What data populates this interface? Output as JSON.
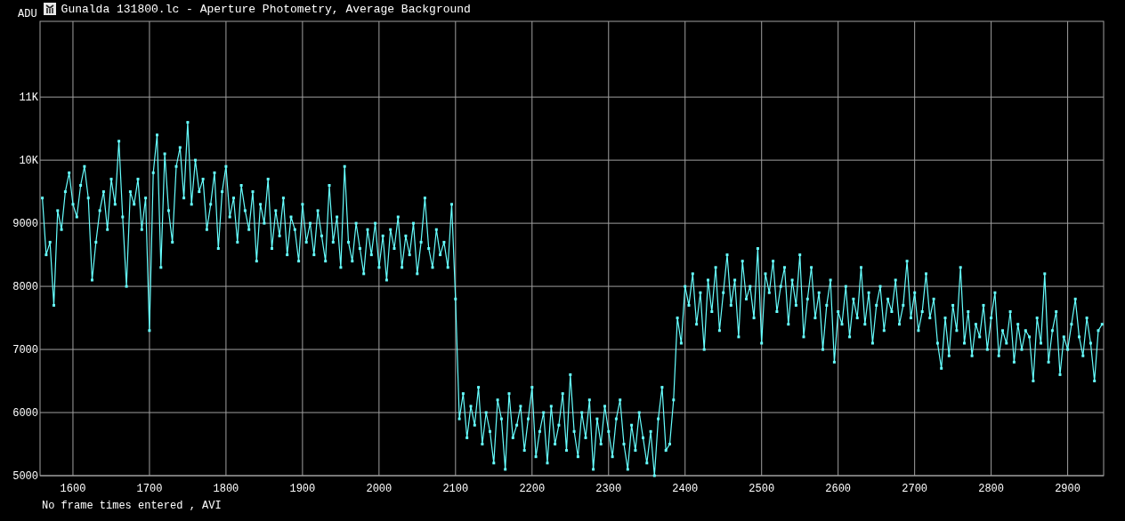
{
  "window": {
    "title": "Gunalda 131800.lc - Aperture Photometry, Average Background"
  },
  "chart_data": {
    "type": "line",
    "grid": true,
    "ylabel": "ADU",
    "xlim": [
      1557,
      2947
    ],
    "ylim": [
      5000,
      12200
    ],
    "xticks": [
      1600,
      1700,
      1800,
      1900,
      2000,
      2100,
      2200,
      2300,
      2400,
      2500,
      2600,
      2700,
      2800,
      2900
    ],
    "yticks": [
      5000,
      6000,
      7000,
      8000,
      9000,
      {
        "value": 10000,
        "label": "10K"
      },
      {
        "value": 11000,
        "label": "11K"
      }
    ],
    "x": [
      1560,
      1565,
      1570,
      1575,
      1580,
      1585,
      1590,
      1595,
      1600,
      1605,
      1610,
      1615,
      1620,
      1625,
      1630,
      1635,
      1640,
      1645,
      1650,
      1655,
      1660,
      1665,
      1670,
      1675,
      1680,
      1685,
      1690,
      1695,
      1700,
      1705,
      1710,
      1715,
      1720,
      1725,
      1730,
      1735,
      1740,
      1745,
      1750,
      1755,
      1760,
      1765,
      1770,
      1775,
      1780,
      1785,
      1790,
      1795,
      1800,
      1805,
      1810,
      1815,
      1820,
      1825,
      1830,
      1835,
      1840,
      1845,
      1850,
      1855,
      1860,
      1865,
      1870,
      1875,
      1880,
      1885,
      1890,
      1895,
      1900,
      1905,
      1910,
      1915,
      1920,
      1925,
      1930,
      1935,
      1940,
      1945,
      1950,
      1955,
      1960,
      1965,
      1970,
      1975,
      1980,
      1985,
      1990,
      1995,
      2000,
      2005,
      2010,
      2015,
      2020,
      2025,
      2030,
      2035,
      2040,
      2045,
      2050,
      2055,
      2060,
      2065,
      2070,
      2075,
      2080,
      2085,
      2090,
      2095,
      2100,
      2105,
      2110,
      2115,
      2120,
      2125,
      2130,
      2135,
      2140,
      2145,
      2150,
      2155,
      2160,
      2165,
      2170,
      2175,
      2180,
      2185,
      2190,
      2195,
      2200,
      2205,
      2210,
      2215,
      2220,
      2225,
      2230,
      2235,
      2240,
      2245,
      2250,
      2255,
      2260,
      2265,
      2270,
      2275,
      2280,
      2285,
      2290,
      2295,
      2300,
      2305,
      2310,
      2315,
      2320,
      2325,
      2330,
      2335,
      2340,
      2345,
      2350,
      2355,
      2360,
      2365,
      2370,
      2375,
      2380,
      2385,
      2390,
      2395,
      2400,
      2405,
      2410,
      2415,
      2420,
      2425,
      2430,
      2435,
      2440,
      2445,
      2450,
      2455,
      2460,
      2465,
      2470,
      2475,
      2480,
      2485,
      2490,
      2495,
      2500,
      2505,
      2510,
      2515,
      2520,
      2525,
      2530,
      2535,
      2540,
      2545,
      2550,
      2555,
      2560,
      2565,
      2570,
      2575,
      2580,
      2585,
      2590,
      2595,
      2600,
      2605,
      2610,
      2615,
      2620,
      2625,
      2630,
      2635,
      2640,
      2645,
      2650,
      2655,
      2660,
      2665,
      2670,
      2675,
      2680,
      2685,
      2690,
      2695,
      2700,
      2705,
      2710,
      2715,
      2720,
      2725,
      2730,
      2735,
      2740,
      2745,
      2750,
      2755,
      2760,
      2765,
      2770,
      2775,
      2780,
      2785,
      2790,
      2795,
      2800,
      2805,
      2810,
      2815,
      2820,
      2825,
      2830,
      2835,
      2840,
      2845,
      2850,
      2855,
      2860,
      2865,
      2870,
      2875,
      2880,
      2885,
      2890,
      2895,
      2900,
      2905,
      2910,
      2915,
      2920,
      2925,
      2930,
      2935,
      2940,
      2945
    ],
    "series": [
      {
        "color": "#66ffff",
        "values": [
          9400,
          8500,
          8700,
          7700,
          9200,
          8900,
          9500,
          9800,
          9300,
          9100,
          9600,
          9900,
          9400,
          8100,
          8700,
          9200,
          9500,
          8900,
          9700,
          9300,
          10300,
          9100,
          8000,
          9500,
          9300,
          9700,
          8900,
          9400,
          7300,
          9800,
          10400,
          8300,
          10100,
          9200,
          8700,
          9900,
          10200,
          9400,
          10600,
          9300,
          10000,
          9500,
          9700,
          8900,
          9300,
          9800,
          8600,
          9500,
          9900,
          9100,
          9400,
          8700,
          9600,
          9200,
          8900,
          9500,
          8400,
          9300,
          9000,
          9700,
          8600,
          9200,
          8800,
          9400,
          8500,
          9100,
          8900,
          8400,
          9300,
          8700,
          9000,
          8500,
          9200,
          8800,
          8400,
          9600,
          8700,
          9100,
          8300,
          9900,
          8700,
          8400,
          9000,
          8600,
          8200,
          8900,
          8500,
          9000,
          8300,
          8800,
          8100,
          8900,
          8600,
          9100,
          8300,
          8800,
          8500,
          9000,
          8200,
          8700,
          9400,
          8600,
          8300,
          8900,
          8500,
          8700,
          8300,
          9300,
          7800,
          5900,
          6300,
          5600,
          6100,
          5800,
          6400,
          5500,
          6000,
          5700,
          5200,
          6200,
          5900,
          5100,
          6300,
          5600,
          5800,
          6100,
          5400,
          5900,
          6400,
          5300,
          5700,
          6000,
          5200,
          6100,
          5500,
          5800,
          6300,
          5400,
          6600,
          5700,
          5300,
          6000,
          5600,
          6200,
          5100,
          5900,
          5500,
          6100,
          5700,
          5300,
          5900,
          6200,
          5500,
          5100,
          5800,
          5400,
          6000,
          5600,
          5200,
          5700,
          5000,
          5900,
          6400,
          5400,
          5500,
          6200,
          7500,
          7100,
          8000,
          7700,
          8200,
          7400,
          7900,
          7000,
          8100,
          7600,
          8300,
          7300,
          7900,
          8500,
          7700,
          8100,
          7200,
          8400,
          7800,
          8000,
          7500,
          8600,
          7100,
          8200,
          7900,
          8400,
          7600,
          8000,
          8300,
          7400,
          8100,
          7700,
          8500,
          7200,
          7800,
          8300,
          7500,
          7900,
          7000,
          7700,
          8100,
          6800,
          7600,
          7400,
          8000,
          7200,
          7800,
          7500,
          8300,
          7400,
          7900,
          7100,
          7700,
          8000,
          7300,
          7800,
          7600,
          8100,
          7400,
          7700,
          8400,
          7500,
          7900,
          7300,
          7600,
          8200,
          7500,
          7800,
          7100,
          6700,
          7500,
          6900,
          7700,
          7300,
          8300,
          7100,
          7600,
          6900,
          7400,
          7200,
          7700,
          7000,
          7500,
          7900,
          6900,
          7300,
          7100,
          7600,
          6800,
          7400,
          7000,
          7300,
          7200,
          6500,
          7500,
          7100,
          8200,
          6800,
          7300,
          7600,
          6600,
          7200,
          7000,
          7400,
          7800,
          7200,
          6900,
          7500,
          7100,
          6500,
          7300,
          7400
        ]
      }
    ]
  },
  "status_bar": {
    "text": "No frame times entered , AVI"
  }
}
